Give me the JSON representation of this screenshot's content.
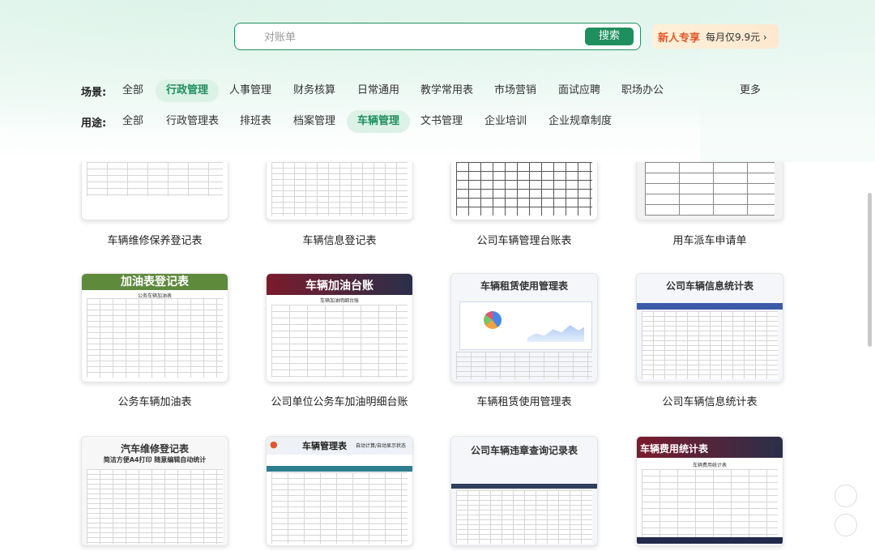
{
  "search": {
    "placeholder": "对账单",
    "button": "搜索"
  },
  "promo": {
    "tag": "新人专享",
    "price": "每月仅9.9元 ›"
  },
  "scene": {
    "label": "场景:",
    "items": [
      "全部",
      "行政管理",
      "人事管理",
      "财务核算",
      "日常通用",
      "教学常用表",
      "市场营销",
      "面试应聘",
      "职场办公"
    ],
    "active": "行政管理",
    "more": "更多"
  },
  "usage": {
    "label": "用途:",
    "items": [
      "全部",
      "行政管理表",
      "排班表",
      "档案管理",
      "车辆管理",
      "文书管理",
      "企业培训",
      "企业规章制度"
    ],
    "active": "车辆管理"
  },
  "templates": [
    {
      "title": "车辆维修保养登记表",
      "banner": ""
    },
    {
      "title": "车辆信息登记表",
      "banner": ""
    },
    {
      "title": "公司车辆管理台账表",
      "banner": ""
    },
    {
      "title": "用车派车申请单",
      "banner": ""
    },
    {
      "title": "公务车辆加油表",
      "banner": "加油表登记表",
      "sub": "公务车辆加油表"
    },
    {
      "title": "公司单位公务车加油明细台账",
      "banner": "车辆加油台账",
      "sub": "车辆加油明细台账"
    },
    {
      "title": "车辆租赁使用管理表",
      "banner": "车辆租赁使用管理表"
    },
    {
      "title": "公司车辆信息统计表",
      "banner": "公司车辆信息统计表"
    },
    {
      "title": "",
      "banner": "汽车维修登记表",
      "sub": "简洁方便A4打印 随意编辑自动统计"
    },
    {
      "title": "",
      "banner": "车辆管理表",
      "sub": "自动计算/自动显示状态"
    },
    {
      "title": "",
      "banner": "公司车辆违章查询记录表"
    },
    {
      "title": "",
      "banner": "车辆费用统计表",
      "sub": "车辆费用统计表"
    }
  ],
  "colors": {
    "accent": "#1f8f5f",
    "active_bg": "#dcf2e6",
    "promo_text": "#e2572a"
  }
}
